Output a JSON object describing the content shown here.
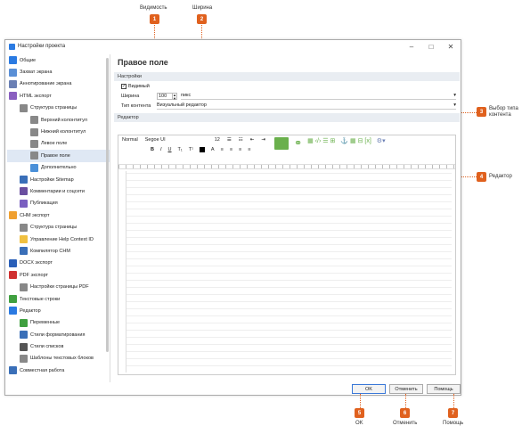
{
  "callouts": {
    "c1": {
      "num": "1",
      "label": "Видимость"
    },
    "c2": {
      "num": "2",
      "label": "Ширина"
    },
    "c3": {
      "num": "3",
      "label": "Выбор типа контента"
    },
    "c4": {
      "num": "4",
      "label": "Редактор"
    },
    "c5": {
      "num": "5",
      "label": "OK"
    },
    "c6": {
      "num": "6",
      "label": "Отменить"
    },
    "c7": {
      "num": "7",
      "label": "Помощь"
    }
  },
  "window": {
    "title": "Настройки проекта",
    "minimize": "–",
    "maximize": "□",
    "close": "✕"
  },
  "sidebar": {
    "items": [
      {
        "label": "Общие",
        "color": "#2a7ae2"
      },
      {
        "label": "Захват экрана",
        "color": "#5a8fd6"
      },
      {
        "label": "Аннотирование экрана",
        "color": "#6a7fb4"
      },
      {
        "label": "HTML экспорт",
        "color": "#8a5fc0"
      },
      {
        "label": "Структура страницы",
        "color": "#888888"
      },
      {
        "label": "Верхний колонтитул",
        "color": "#888888"
      },
      {
        "label": "Нижний колонтитул",
        "color": "#888888"
      },
      {
        "label": "Левое поле",
        "color": "#888888"
      },
      {
        "label": "Правое поле",
        "color": "#888888"
      },
      {
        "label": "Дополнительно",
        "color": "#4a90d9"
      },
      {
        "label": "Настройки Sitemap",
        "color": "#3a6fb8"
      },
      {
        "label": "Комментарии и соцсети",
        "color": "#6a4fa0"
      },
      {
        "label": "Публикация",
        "color": "#7a5fc0"
      },
      {
        "label": "CHM экспорт",
        "color": "#f0a030"
      },
      {
        "label": "Структура страницы",
        "color": "#888888"
      },
      {
        "label": "Управление Help Context ID",
        "color": "#f0c040"
      },
      {
        "label": "Компилятор CHM",
        "color": "#3a6fb8"
      },
      {
        "label": "DOCX экспорт",
        "color": "#2a5fb8"
      },
      {
        "label": "PDF экспорт",
        "color": "#d03030"
      },
      {
        "label": "Настройки страницы PDF",
        "color": "#888888"
      },
      {
        "label": "Текстовые строки",
        "color": "#40a040"
      },
      {
        "label": "Редактор",
        "color": "#2a7ae2"
      },
      {
        "label": "Переменные",
        "color": "#40a040"
      },
      {
        "label": "Стили форматирования",
        "color": "#3a6fb8"
      },
      {
        "label": "Стили списков",
        "color": "#555555"
      },
      {
        "label": "Шаблоны текстовых блоков",
        "color": "#888888"
      },
      {
        "label": "Совместная работа",
        "color": "#3a6fb8"
      }
    ]
  },
  "main": {
    "title": "Правое поле",
    "settings_header": "Настройки",
    "visible_label": "Видимый",
    "width_label": "Ширина",
    "width_value": "100",
    "width_unit": "пикс",
    "content_type_label": "Тип контента",
    "content_type_value": "Визуальный редактор",
    "editor_header": "Редактор"
  },
  "toolbar": {
    "style": "Normal",
    "font": "Segoe UI",
    "size": "12",
    "bold": "B",
    "italic": "I",
    "underline": "U",
    "subscript": "T₁",
    "superscript": "T¹",
    "text_color": "A"
  },
  "buttons": {
    "ok": "OK",
    "cancel": "Отменить",
    "help": "Помощь"
  },
  "colors": {
    "accent": "#e0611e",
    "active_item": "#dfe8f4",
    "section_bg": "#e9edf2"
  }
}
